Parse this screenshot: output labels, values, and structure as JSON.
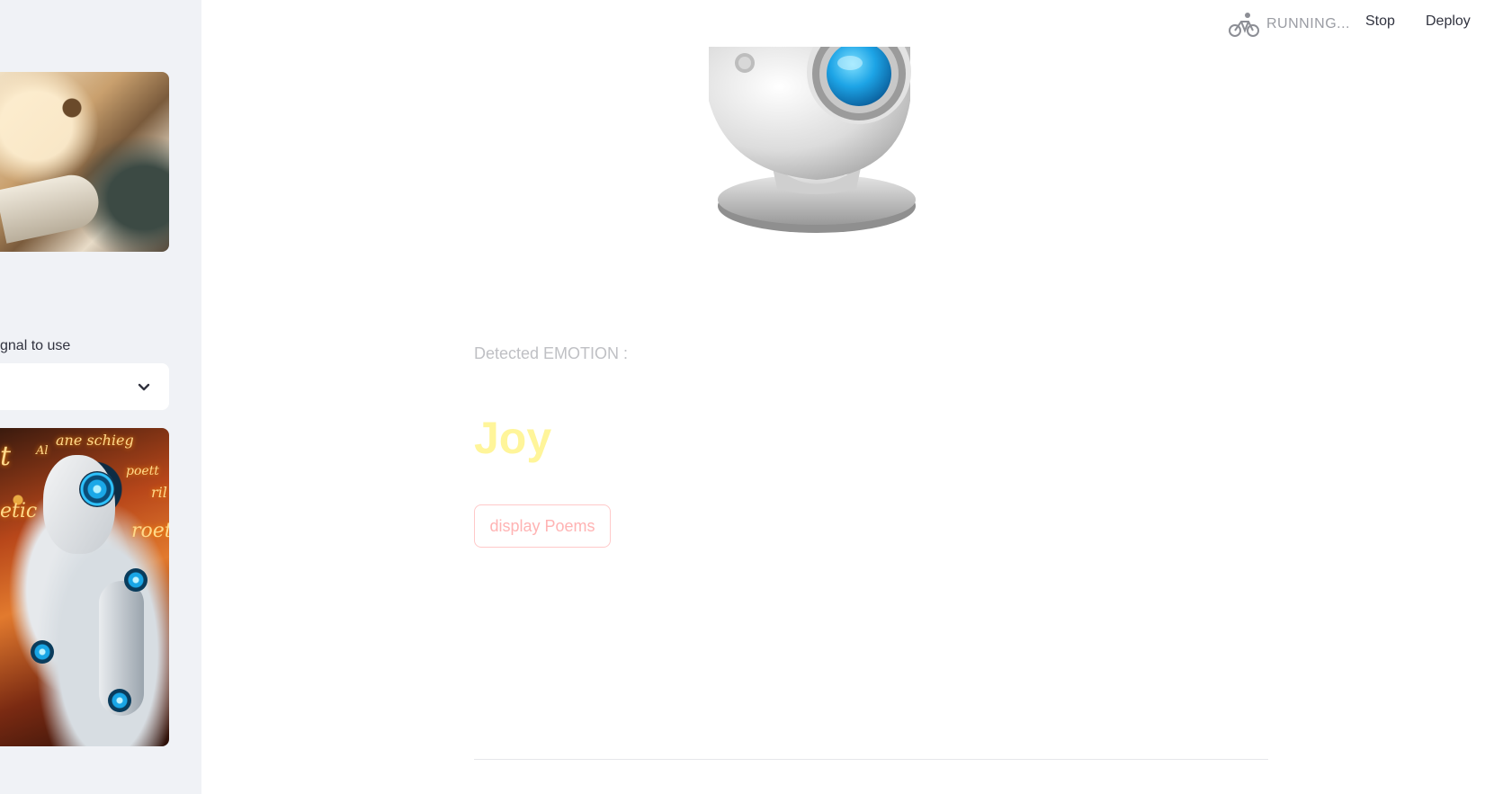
{
  "sidebar": {
    "top_image": {
      "alt": "poetry-scroll-art"
    },
    "select": {
      "label": "gnal to use",
      "value": ""
    },
    "bottom_image": {
      "alt": "ai-robot-poet-art",
      "words": [
        "ane schieg",
        "Al",
        "t",
        "poett",
        "etic",
        "roet",
        "ril"
      ]
    }
  },
  "header": {
    "status": "RUNNING...",
    "stop_label": "Stop",
    "deploy_label": "Deploy"
  },
  "main": {
    "webcam_icon": "webcam-icon",
    "emotion_label": "Detected EMOTION :",
    "emotion_value": "Joy",
    "display_button": "display Poems"
  },
  "colors": {
    "sidebar_bg": "#f0f2f6",
    "emotion_color": "#fff59a",
    "button_border": "#ffc9c9",
    "button_text": "#ffb3b3"
  }
}
